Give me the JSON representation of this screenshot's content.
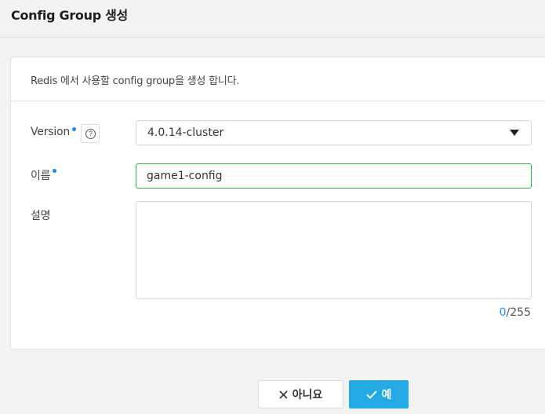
{
  "header": {
    "title": "Config Group 생성"
  },
  "card": {
    "description": "Redis 에서 사용할 config group을 생성 합니다."
  },
  "form": {
    "version": {
      "label": "Version",
      "help_icon": "question-circle-icon",
      "value": "4.0.14-cluster"
    },
    "name": {
      "label": "이름",
      "value": "game1-config"
    },
    "description": {
      "label": "설명",
      "value": "",
      "count_current": "0",
      "count_max": "/255"
    }
  },
  "buttons": {
    "cancel": {
      "label": "아니요",
      "icon": "close-icon"
    },
    "confirm": {
      "label": "예",
      "icon": "check-icon"
    }
  },
  "colors": {
    "accent": "#25a9e5",
    "required_dot": "#1e88e5",
    "focus_border": "#2fa84f",
    "counter_current": "#2196f3"
  }
}
